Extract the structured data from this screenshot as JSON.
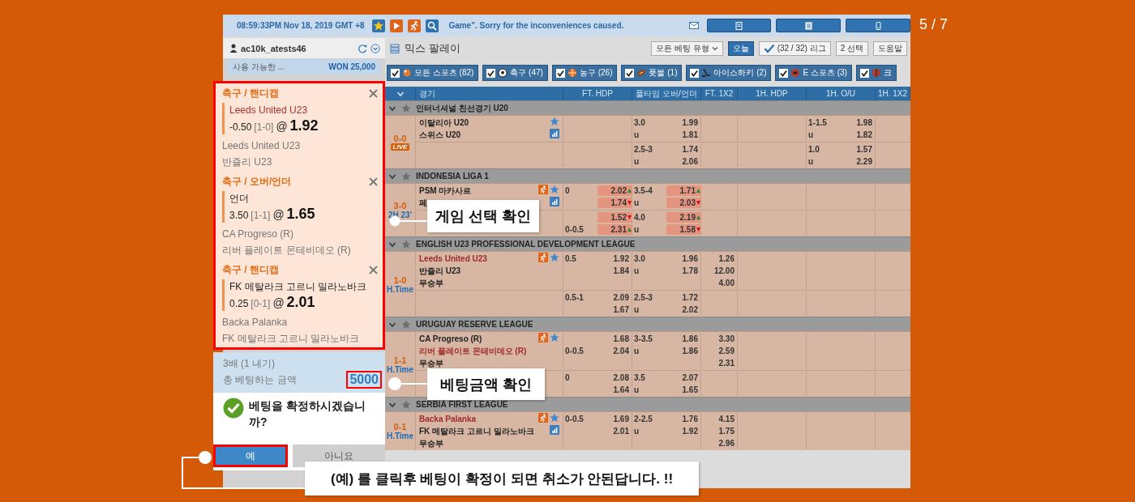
{
  "slide_counter": "5 / 7",
  "top_bar": {
    "time": "08:59:33PM Nov 18, 2019 GMT +8",
    "notice": "Game\". Sorry for the inconveniences caused."
  },
  "account": {
    "username": "ac10k_atests46",
    "balance_label": "사용 가능한 ...",
    "balance": "WON 25,000"
  },
  "page_title": "믹스 팔레이",
  "toolbar": [
    {
      "kind": "dropdown",
      "label": "모든 베팅 유형",
      "selected": false
    },
    {
      "kind": "button",
      "label": "오늘",
      "selected": true
    },
    {
      "kind": "check",
      "label": "(32 / 32) 리그",
      "selected": false
    },
    {
      "kind": "button",
      "label": "2 선택",
      "selected": false
    },
    {
      "kind": "button",
      "label": "도움말",
      "selected": false
    }
  ],
  "sport_filters": [
    {
      "kind": "all",
      "label": "모든 스포츠 (82)",
      "checked": true
    },
    {
      "kind": "soccer",
      "label": "축구 (47)",
      "checked": true
    },
    {
      "kind": "basketball",
      "label": "농구 (26)",
      "checked": true
    },
    {
      "kind": "football",
      "label": "풋볼 (1)",
      "checked": true
    },
    {
      "kind": "hockey",
      "label": "아이스하키 (2)",
      "checked": true
    },
    {
      "kind": "esports",
      "label": "E 스포츠 (3)",
      "checked": true
    },
    {
      "kind": "other",
      "label": "크",
      "checked": true
    }
  ],
  "table": {
    "columns": [
      "경기",
      "FT. HDP",
      "풀타임 오버/언더",
      "FT. 1X2",
      "1H. HDP",
      "1H. O/U",
      "1H. 1X2"
    ],
    "leagues": [
      {
        "name": "인터너셔널 친선경기 U20",
        "matches": [
          {
            "score": "0-0",
            "live": "LIVE",
            "tracker": false,
            "stats": true,
            "teams": [
              {
                "name": "이탈리아 U20",
                "favorite": false
              },
              {
                "name": "스위스 U20",
                "favorite": false
              }
            ],
            "blocks": [
              [
                {
                  "ou": "3.0",
                  "ou_odds": "1.99",
                  "h1_ou": "1-1.5",
                  "h1_ou_odds": "1.98"
                },
                {
                  "ou": "u",
                  "ou_odds": "1.81",
                  "h1_ou": "u",
                  "h1_ou_odds": "1.82"
                }
              ],
              [
                {
                  "ou": "2.5-3",
                  "ou_odds": "1.74",
                  "h1_ou": "1.0",
                  "h1_ou_odds": "1.57"
                },
                {
                  "ou": "u",
                  "ou_odds": "2.06",
                  "h1_ou": "u",
                  "h1_ou_odds": "2.29"
                }
              ]
            ]
          }
        ]
      },
      {
        "name": "INDONESIA LIGA 1",
        "matches": [
          {
            "score": "3-0",
            "time": "2H 23'",
            "tracker": true,
            "stats": true,
            "teams": [
              {
                "name": "PSM 마카사르",
                "favorite": false
              },
              {
                "name": "페",
                "favorite": false
              }
            ],
            "blocks": [
              [
                {
                  "hdp": "0",
                  "hdp_odds": {
                    "text": "2.02",
                    "rising": true
                  },
                  "ou": "3.5-4",
                  "ou_odds": {
                    "text": "1.71",
                    "rising": true
                  }
                },
                {
                  "hdp_odds": {
                    "text": "1.74",
                    "rising": false
                  },
                  "ou": "u",
                  "ou_odds": {
                    "text": "2.03",
                    "rising": false
                  }
                }
              ],
              [
                {
                  "hdp_odds": {
                    "text": "1.52",
                    "rising": false
                  },
                  "ou": "4.0",
                  "ou_odds": {
                    "text": "2.19",
                    "rising": true
                  }
                },
                {
                  "hdp": "0-0.5",
                  "hdp_odds": {
                    "text": "2.31",
                    "rising": true
                  },
                  "ou": "u",
                  "ou_odds": {
                    "text": "1.58",
                    "rising": false
                  }
                }
              ]
            ]
          }
        ]
      },
      {
        "name": "ENGLISH U23 PROFESSIONAL DEVELOPMENT LEAGUE",
        "matches": [
          {
            "score": "1-0",
            "time": "H.Time",
            "tracker": true,
            "stats": false,
            "teams": [
              {
                "name": "Leeds United U23",
                "favorite": true
              },
              {
                "name": "반즐리 U23",
                "favorite": false
              },
              {
                "name": "무승부",
                "favorite": false
              }
            ],
            "blocks": [
              [
                {
                  "hdp": "0.5",
                  "hdp_odds": "1.92",
                  "ou": "3.0",
                  "ou_odds": "1.96",
                  "x12": "1.26"
                },
                {
                  "hdp_odds": "1.84",
                  "ou": "u",
                  "ou_odds": "1.78",
                  "x12": "12.00"
                },
                {
                  "x12": "4.00"
                }
              ],
              [
                {
                  "hdp": "0.5-1",
                  "hdp_odds": "2.09",
                  "ou": "2.5-3",
                  "ou_odds": "1.72"
                },
                {
                  "hdp_odds": "1.67",
                  "ou": "u",
                  "ou_odds": "2.02"
                }
              ]
            ]
          }
        ]
      },
      {
        "name": "URUGUAY RESERVE LEAGUE",
        "matches": [
          {
            "score": "1-1",
            "time": "H.Time",
            "tracker": true,
            "stats": false,
            "teams": [
              {
                "name": "CA Progreso (R)",
                "favorite": false
              },
              {
                "name": "리버 플레이트 몬테비데오 (R)",
                "favorite": true
              },
              {
                "name": "무승부",
                "favorite": false
              }
            ],
            "blocks": [
              [
                {
                  "hdp_odds": "1.68",
                  "ou": "3-3.5",
                  "ou_odds": "1.86",
                  "x12": "3.30"
                },
                {
                  "hdp": "0-0.5",
                  "hdp_odds": "2.04",
                  "ou": "u",
                  "ou_odds": "1.86",
                  "x12": "2.59"
                },
                {
                  "x12": "2.31"
                }
              ],
              [
                {
                  "hdp": "0",
                  "hdp_odds": "2.08",
                  "ou": "3.5",
                  "ou_odds": "2.07"
                },
                {
                  "hdp_odds": "1.64",
                  "ou": "u",
                  "ou_odds": "1.65"
                }
              ]
            ]
          }
        ]
      },
      {
        "name": "SERBIA FIRST LEAGUE",
        "matches": [
          {
            "score": "0-1",
            "time": "H.Time",
            "tracker": true,
            "stats": true,
            "teams": [
              {
                "name": "Backa Palanka",
                "favorite": true
              },
              {
                "name": "FK 메탈라크 고르니 밀라노바크",
                "favorite": false
              },
              {
                "name": "무승부",
                "favorite": false
              }
            ],
            "blocks": [
              [
                {
                  "hdp": "0-0.5",
                  "hdp_odds": "1.69",
                  "ou": "2-2.5",
                  "ou_odds": "1.76",
                  "x12": "4.15"
                },
                {
                  "hdp_odds": "2.01",
                  "ou": "u",
                  "ou_odds": "1.92",
                  "x12": "1.75"
                },
                {
                  "x12": "2.96"
                }
              ]
            ]
          }
        ]
      }
    ]
  },
  "bet_slip": {
    "selections": [
      {
        "market": "축구 / 핸디캡",
        "pick": "Leeds United U23",
        "favorite": true,
        "line": "-0.50",
        "score": "[1-0]",
        "at": "@",
        "odds": "1.92",
        "home": "Leeds United U23",
        "away": "반즐리 U23"
      },
      {
        "market": "축구 / 오버/언더",
        "pick": "언더",
        "favorite": false,
        "line": "3.50",
        "score": "[1-1]",
        "at": "@",
        "odds": "1.65",
        "home": "CA Progreso (R)",
        "away": "리버 플레이트 몬테비데오 (R)"
      },
      {
        "market": "축구 / 핸디캡",
        "pick": "FK 메탈라크 고르니 밀라노바크",
        "favorite": false,
        "line": "0.25",
        "score": "[0-1]",
        "at": "@",
        "odds": "2.01",
        "home": "Backa Palanka",
        "away": "FK 메탈라크 고르니 밀라노바크"
      }
    ],
    "multiplier": "3배 (1 내기)",
    "total_label": "총 베팅하는 금액",
    "total": "5000",
    "confirm_question": "베팅을 확정하시겠습니까?",
    "buttons": [
      {
        "kind": "primary",
        "label": "예"
      },
      {
        "kind": "secondary",
        "label": "아니요"
      }
    ]
  },
  "callouts": [
    {
      "text": "게임 선택 확인"
    },
    {
      "text": "베팅금액 확인"
    },
    {
      "text": "(예) 를 클릭후 베팅이 확정이 되면 취소가 안된답니다. !!"
    }
  ]
}
